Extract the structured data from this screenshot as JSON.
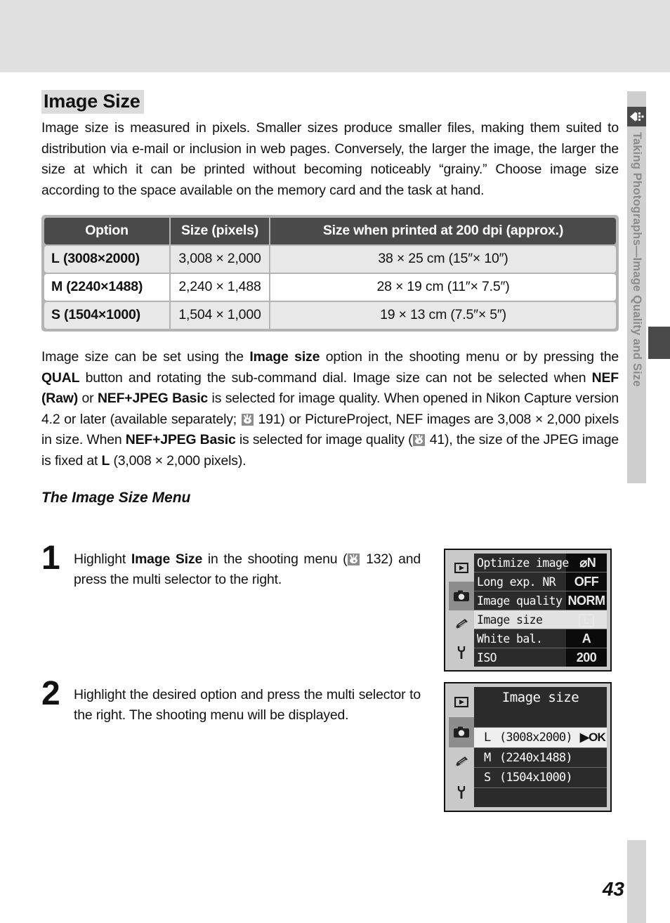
{
  "page": {
    "number": "43",
    "section_tab": "Taking Photographs—Image Quality and Size",
    "tab_icon": "multi-selector-icon"
  },
  "heading": "Image Size",
  "intro_paragraph": "Image size is measured in pixels.  Smaller sizes produce smaller files, making them suited to distribution via e-mail or inclusion in web pages.  Conversely, the larger the image, the larger the size at which it can be printed without becoming noticeably “grainy.”  Choose image size according to the space available on the memory card and the task at hand.",
  "table": {
    "headers": [
      "Option",
      "Size (pixels)",
      "Size when printed at 200 dpi (approx.)"
    ],
    "rows": [
      {
        "option_letter": "L",
        "option_dims": "(3008×2000)",
        "size_pixels": "3,008 × 2,000",
        "printed_size": "38 × 25 cm  (15″× 10″)"
      },
      {
        "option_letter": "M",
        "option_dims": "(2240×1488)",
        "size_pixels": "2,240 × 1,488",
        "printed_size": "28 × 19 cm (11″× 7.5″)"
      },
      {
        "option_letter": "S",
        "option_dims": "(1504×1000)",
        "size_pixels": "1,504 × 1,000",
        "printed_size": "19 × 13 cm   (7.5″× 5″)"
      }
    ]
  },
  "detail_paragraph": {
    "p1": "Image size can be set using the ",
    "b1": "Image size",
    "p2": " option in the shooting menu or by pressing the ",
    "b2": "QUAL",
    "p3": " button and rotating the sub-command dial.  Image size can not be selected when ",
    "b3": "NEF (Raw)",
    "p4": " or ",
    "b4": "NEF+JPEG Basic",
    "p5": " is selected for image quality.  When opened in Nikon Capture version 4.2 or later (available separately; ",
    "ref1": "191",
    "p6": ") or PictureProject, NEF images are 3,008 × 2,000 pixels in size.  When ",
    "b5": "NEF+JPEG Basic",
    "p7": " is selected for image quality (",
    "ref2": "41",
    "p8": "), the size of the JPEG image is fixed at ",
    "b6": "L",
    "p9": " (3,008 × 2,000 pixels)."
  },
  "subheading": "The Image Size Menu",
  "steps": [
    {
      "number": "1",
      "t1": "Highlight ",
      "b1": "Image Size",
      "t2": " in the shooting menu (",
      "ref": "132",
      "t3": ") and press the multi selector to the right."
    },
    {
      "number": "2",
      "t1": "Highlight the desired option and press the multi selector to the right.  The shooting menu will be displayed.",
      "b1": "",
      "t2": "",
      "ref": "",
      "t3": ""
    }
  ],
  "lcd_shooting_menu": {
    "sidebar_icons": [
      "playback-icon",
      "camera-icon",
      "pencil-icon",
      "wrench-icon"
    ],
    "active_icon": "camera-icon",
    "rows": [
      {
        "label": "Optimize image",
        "value": "⌀N",
        "selected": false
      },
      {
        "label": "Long exp. NR",
        "value": "OFF",
        "selected": false
      },
      {
        "label": "Image quality",
        "value": "NORM",
        "selected": false
      },
      {
        "label": "Image size",
        "value": "L",
        "selected": true
      },
      {
        "label": "White bal.",
        "value": "A",
        "selected": false
      },
      {
        "label": "ISO",
        "value": "200",
        "selected": false
      }
    ]
  },
  "lcd_image_size_menu": {
    "title": "Image size",
    "sidebar_icons": [
      "playback-icon",
      "camera-icon",
      "pencil-icon",
      "wrench-icon"
    ],
    "active_icon": "camera-icon",
    "options": [
      {
        "code": "",
        "label": "",
        "selected": false,
        "ok": ""
      },
      {
        "code": "L",
        "label": "(3008x2000)",
        "selected": true,
        "ok": "▶OK"
      },
      {
        "code": "M",
        "label": "(2240x1488)",
        "selected": false,
        "ok": ""
      },
      {
        "code": "S",
        "label": "(1504x1000)",
        "selected": false,
        "ok": ""
      },
      {
        "code": "",
        "label": "",
        "selected": false,
        "ok": ""
      }
    ]
  },
  "colors": {
    "top_band": "#e0e0e0",
    "table_header": "#4a4a4a",
    "row_shade": "#e8e8e8",
    "tab_gray": "#cfcfcf",
    "tab_marker": "#4a4a4a",
    "lcd_bezel": "#c9c9c9",
    "lcd_screen": "#2b2b2b"
  }
}
